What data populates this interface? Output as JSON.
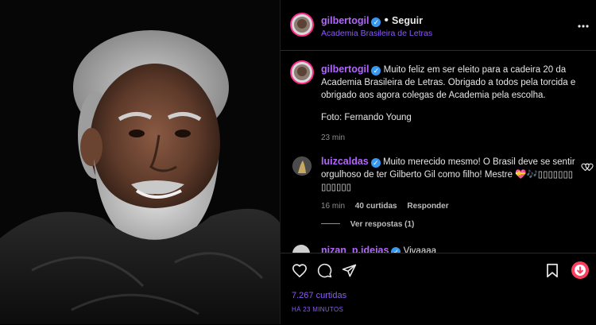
{
  "post": {
    "username": "gilbertogil",
    "follow_label": "Seguir",
    "location": "Academia Brasileira de Letras",
    "caption_line1": "Muito feliz em ser eleito para a cadeira 20 da",
    "caption_line2": "Academia Brasileira de Letras. Obrigado a todos pela torcida e",
    "caption_line3": "obrigado aos agora colegas de Academia pela escolha.",
    "photo_credit": "Foto: Fernando Young",
    "time": "23 min"
  },
  "comments": [
    {
      "username": "luizcaldas",
      "text_line1": "Muito merecido mesmo! O Brasil deve se sentir",
      "text_line2": "orgulhoso de ter Gilberto Gil como filho! Mestre 💝🎶▯▯▯▯▯▯▯",
      "text_line3": "▯▯▯▯▯▯",
      "time": "16 min",
      "likes": "40 curtidas",
      "reply_label": "Responder",
      "view_replies": "Ver respostas (1)"
    },
    {
      "username": "nizan_p.ideias",
      "text": "Vivaaaa"
    }
  ],
  "footer": {
    "likes": "7.267 curtidas",
    "timestamp": "HÁ 23 MINUTOS"
  },
  "icons": [
    "heart-icon",
    "comment-icon",
    "share-icon",
    "bookmark-icon",
    "more-icon",
    "download-icon"
  ],
  "colors": {
    "username": "#b266ff",
    "link": "#8a5cf6",
    "verified": "#3897f0",
    "background": "#000000"
  }
}
